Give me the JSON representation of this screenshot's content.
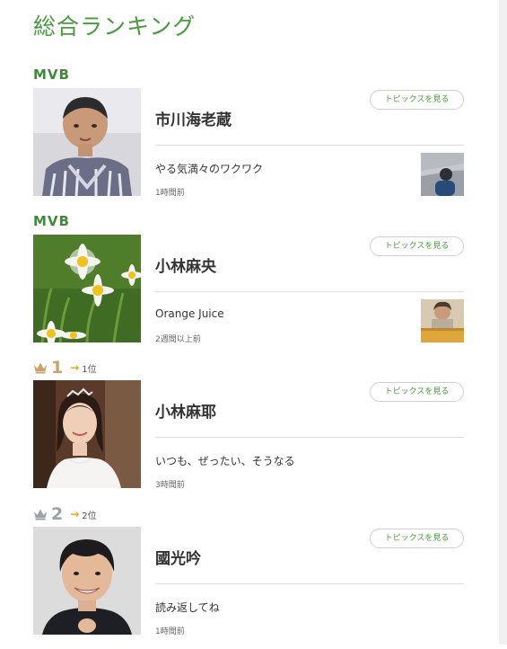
{
  "page_title": "総合ランキング",
  "entries": [
    {
      "label_type": "mvb",
      "label": "MVB",
      "name": "市川海老蔵",
      "button": "トピックスを見る",
      "post_title": "やる気満々のワクワク",
      "post_time": "1時間前",
      "has_thumb": true
    },
    {
      "label_type": "mvb",
      "label": "MVB",
      "name": "小林麻央",
      "button": "トピックスを見る",
      "post_title": "Orange Juice",
      "post_time": "2週間以上前",
      "has_thumb": true
    },
    {
      "label_type": "rank",
      "rank": "1",
      "rank_change": "1位",
      "crown_color": "#c9a36a",
      "name": "小林麻耶",
      "button": "トピックスを見る",
      "post_title": "いつも、ぜったい、そうなる",
      "post_time": "3時間前",
      "has_thumb": false
    },
    {
      "label_type": "rank",
      "rank": "2",
      "rank_change": "2位",
      "crown_color": "#9aa3ad",
      "name": "國光吟",
      "button": "トピックスを見る",
      "post_title": "読み返してね",
      "post_time": "1時間前",
      "has_thumb": false
    }
  ]
}
